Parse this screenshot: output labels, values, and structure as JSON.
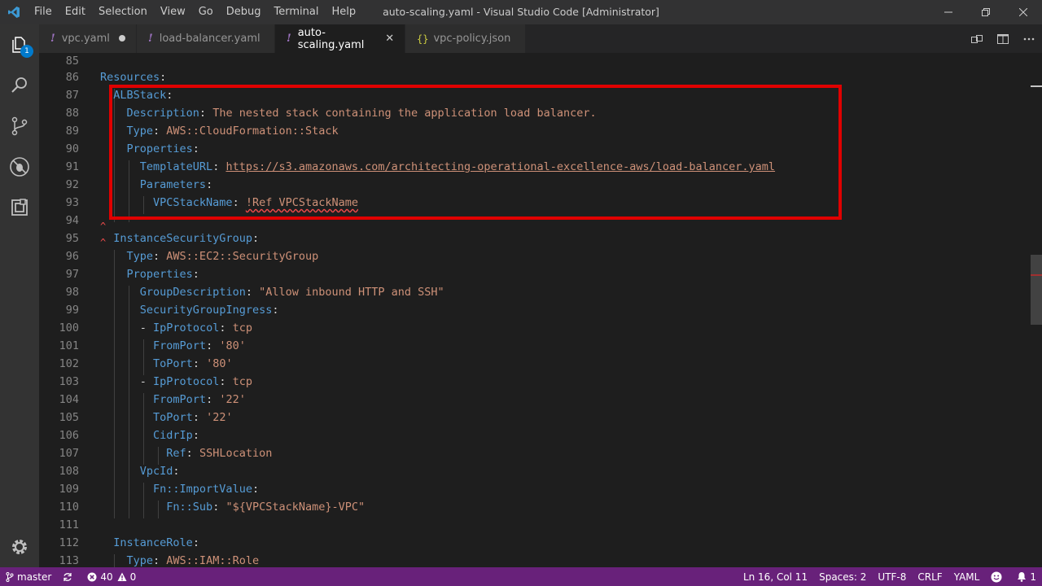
{
  "titlebar": {
    "menu": [
      "File",
      "Edit",
      "Selection",
      "View",
      "Go",
      "Debug",
      "Terminal",
      "Help"
    ],
    "window_title": "auto-scaling.yaml - Visual Studio Code [Administrator]"
  },
  "activitybar": {
    "icons": [
      "explorer-icon",
      "search-icon",
      "source-control-icon",
      "debug-icon",
      "extensions-icon"
    ],
    "explorer_badge": "1",
    "bottom_icon": "gear-icon"
  },
  "tabs": [
    {
      "label": "vpc.yaml",
      "icon": "yaml",
      "state": "dirty"
    },
    {
      "label": "load-balancer.yaml",
      "icon": "yaml",
      "state": "normal"
    },
    {
      "label": "auto-scaling.yaml",
      "icon": "yaml",
      "state": "active"
    },
    {
      "label": "vpc-policy.json",
      "icon": "json",
      "state": "normal"
    }
  ],
  "editor_action_icons": [
    "open-changes-icon",
    "split-editor-icon",
    "more-actions-icon"
  ],
  "editor": {
    "line_numbers": [
      "85",
      "86",
      "87",
      "88",
      "89",
      "90",
      "91",
      "92",
      "93",
      "94",
      "95",
      "96",
      "97",
      "98",
      "99",
      "100",
      "101",
      "102",
      "103",
      "104",
      "105",
      "106",
      "107",
      "108",
      "109",
      "110",
      "111",
      "112",
      "113"
    ],
    "code": {
      "l86_key": "Resources",
      "l87_key": "ALBStack",
      "l88_key": "Description",
      "l88_val": "The nested stack containing the application load balancer.",
      "l89_key": "Type",
      "l89_val": "AWS::CloudFormation::Stack",
      "l90_key": "Properties",
      "l91_key": "TemplateURL",
      "l91_val": "https://s3.amazonaws.com/architecting-operational-excellence-aws/load-balancer.yaml",
      "l92_key": "Parameters",
      "l93_key": "VPCStackName",
      "l93_val": "!Ref VPCStackName",
      "l95_key": "InstanceSecurityGroup",
      "l96_key": "Type",
      "l96_val": "AWS::EC2::SecurityGroup",
      "l97_key": "Properties",
      "l98_key": "GroupDescription",
      "l98_val": "\"Allow inbound HTTP and SSH\"",
      "l99_key": "SecurityGroupIngress",
      "l100_key": "IpProtocol",
      "l100_val": "tcp",
      "l101_key": "FromPort",
      "l101_val": "'80'",
      "l102_key": "ToPort",
      "l102_val": "'80'",
      "l103_key": "IpProtocol",
      "l103_val": "tcp",
      "l104_key": "FromPort",
      "l104_val": "'22'",
      "l105_key": "ToPort",
      "l105_val": "'22'",
      "l106_key": "CidrIp",
      "l107_key": "Ref",
      "l107_val": "SSHLocation",
      "l108_key": "VpcId",
      "l109_key": "Fn::ImportValue",
      "l110_key": "Fn::Sub",
      "l110_val": "\"${VPCStackName}-VPC\"",
      "l112_key": "InstanceRole",
      "l113_key": "Type",
      "l113_val": "AWS::IAM::Role"
    }
  },
  "statusbar": {
    "branch": "master",
    "errors": "40",
    "warnings": "0",
    "position": "Ln 16, Col 11",
    "spaces": "Spaces: 2",
    "encoding": "UTF-8",
    "eol": "CRLF",
    "language": "YAML",
    "notifications": "1"
  },
  "colors": {
    "statusbar": "#68217a",
    "highlight_box": "#e00000",
    "yaml_key": "#569cd6",
    "yaml_string": "#ce9178"
  }
}
